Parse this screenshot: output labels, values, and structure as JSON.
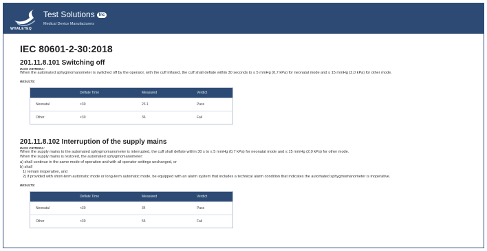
{
  "header": {
    "brand": "Test Solutions",
    "badge": "Inc",
    "logo_text": "WHALETEQ",
    "tagline": "Medical Device Manufacturers"
  },
  "standard": "IEC 80601-2-30:2018",
  "labels": {
    "pass_criteria": "PASS CRITERIA:",
    "results": "RESULTS:"
  },
  "sections": [
    {
      "title": "201.11.8.101 Switching off",
      "criteria": [
        "When the automated sphygmomanometer is switched off by the operator, with the cuff inflated, the cuff shall deflate within 30 seconds to ≤ 5 mmHg (0,7 kPa) for neonatal mode and ≤ 15 mmHg (2,0 kPa) for other mode."
      ],
      "table": {
        "headers": [
          "",
          "Deflate Time",
          "Measured",
          "Verdict"
        ],
        "rows": [
          [
            "Neonatal",
            "<30",
            "23.1",
            "Pass"
          ],
          [
            "Other",
            "<30",
            "36",
            "Fail"
          ]
        ]
      }
    },
    {
      "title": "201.11.8.102 Interruption of the supply mains",
      "criteria": [
        "When the supply mains to the automated sphygmomanometer is interrupted, the cuff shall deflate within 30 s to ≤ 5 mmHg (0,7 kPa) for neonatal mode and ≤ 15 mmHg (2,0 kPa) for other mode.",
        "When the supply mains is restored, the automated sphygmomanometer:",
        "a) shall continue in the same mode of operation and with all operator settings unchanged, or",
        "b) shall",
        "  1) remain inoperative, and",
        "  2) if provided with short-term automatic mode or long-term automatic mode, be equipped with an alarm system that includes a technical alarm condition that indicates the automated sphygmomanometer is inoperative."
      ],
      "table": {
        "headers": [
          "",
          "Deflate Time",
          "Measured",
          "Verdict"
        ],
        "rows": [
          [
            "Neonatal",
            "<30",
            "34",
            "Pass"
          ],
          [
            "Other",
            "<30",
            "55",
            "Fail"
          ]
        ]
      }
    }
  ]
}
